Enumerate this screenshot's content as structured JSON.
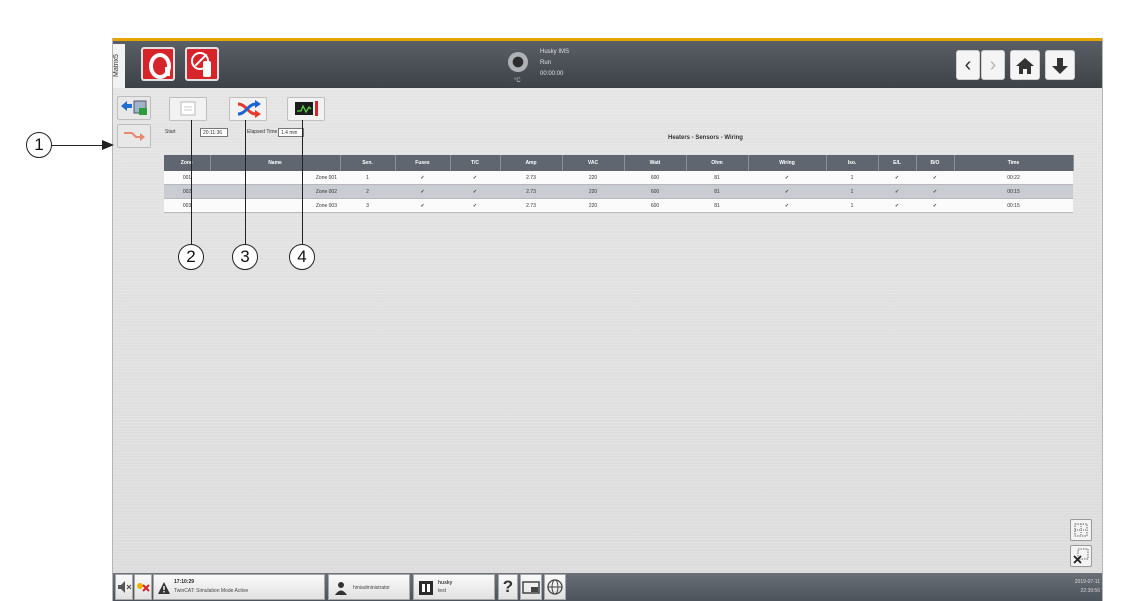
{
  "app": {
    "side_label": "Matrix5"
  },
  "topbar": {
    "status_lines": [
      "Husky IMS",
      "Run",
      "00:00:00"
    ],
    "temp_unit": "°C"
  },
  "report": {
    "start_label": "Start",
    "start_value": "20:11:36",
    "elapsed_label": "Elapsed Time",
    "elapsed_value": "1.4 min",
    "title": "Heaters - Sensors - Wiring"
  },
  "table": {
    "columns": [
      "Zone",
      "Name",
      "Sen.",
      "Fuses",
      "T/C",
      "Amp",
      "VAC",
      "Watt",
      "Ohm",
      "Wiring",
      "Iso.",
      "E/L",
      "B/O",
      "Time"
    ],
    "rows": [
      {
        "zone": "001",
        "name": "Zone 001",
        "sen": "1",
        "amp": "2.73",
        "vac": "220",
        "watt": "600",
        "ohm": "81",
        "iso": "1",
        "time": "00:22"
      },
      {
        "zone": "002",
        "name": "Zone 002",
        "sen": "2",
        "amp": "2.73",
        "vac": "220",
        "watt": "600",
        "ohm": "81",
        "iso": "1",
        "time": "00:15"
      },
      {
        "zone": "003",
        "name": "Zone 003",
        "sen": "3",
        "amp": "2.73",
        "vac": "220",
        "watt": "600",
        "ohm": "81",
        "iso": "1",
        "time": "00:15"
      }
    ],
    "check_glyph": "✓"
  },
  "statusbar": {
    "time": "17:10:29",
    "alarm_text": "TwinCAT: Simulation Mode Active",
    "user": "hmiadministrator",
    "mold_name": "husky",
    "mold_sub": "test",
    "help": "?",
    "date": "2019-07-11",
    "clock": "22:39:56"
  },
  "callouts": [
    "1",
    "2",
    "3",
    "4"
  ],
  "colors": {
    "accent": "#e5a400",
    "alarm_red": "#d7242a",
    "check_green": "#3bbf2e"
  }
}
